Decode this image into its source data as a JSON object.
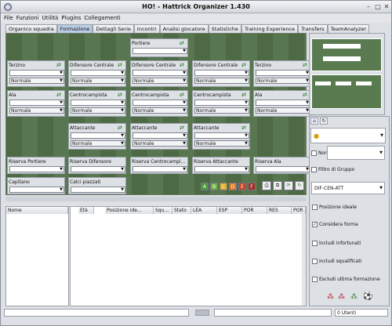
{
  "window": {
    "title": "HO! - Hattrick Organizer 1.430"
  },
  "menu": [
    "File",
    "Funzioni",
    "Utilità",
    "Plugins",
    "Collegamenti"
  ],
  "tabs": [
    "Organico squadra",
    "Formazione",
    "Dettagli Serie",
    "Incontri",
    "Analisi giocatore",
    "Statistiche",
    "Training Experience",
    "Transfers",
    "TeamAnalyzer"
  ],
  "active_tab": "Formazione",
  "lineup": {
    "portiere": "Portiere",
    "terzino_l": "Terzino",
    "dif_c1": "Difensore Centrale",
    "dif_c2": "Difensore Centrale",
    "dif_c3": "Difensore Centrale",
    "terzino_r": "Terzino",
    "ala_l": "Ala",
    "cc1": "Centrocampista",
    "cc2": "Centrocampista",
    "cc3": "Centrocampista",
    "ala_r": "Ala",
    "att1": "Attaccante",
    "att2": "Attaccante",
    "att3": "Attaccante",
    "ris_portiere": "Riserva Portiere",
    "ris_difensore": "Riserva Difensore",
    "ris_centrocampista": "Riserva Centrocampi...",
    "ris_attaccante": "Riserva Attaccante",
    "ris_ala": "Riserva Ala",
    "capitano": "Capitano",
    "calci_piazzati": "Calci piazzati",
    "behaviour": "Normale"
  },
  "bottom_left_header": "Nome",
  "table_headers": [
    "Età",
    "Posizione ide...",
    "Squ...",
    "Stato",
    "LEA",
    "ESP",
    "POR",
    "RES",
    "POR"
  ],
  "right_panel": {
    "non_label": "Non",
    "filtro_gruppo": "Filtro di Gruppo",
    "position_select": "DIF-CEN-ATT",
    "checks": [
      {
        "label": "Posizione ideale",
        "checked": false
      },
      {
        "label": "Considera forma",
        "checked": true
      },
      {
        "label": "Includi infortunati",
        "checked": false
      },
      {
        "label": "Includi squalificati",
        "checked": false
      },
      {
        "label": "Escludi ultima formazione",
        "checked": false
      }
    ]
  },
  "status": {
    "utenti": "0 Utenti"
  },
  "colors": {
    "pitch": "#58764f",
    "tab_active": "#b9cde6"
  }
}
